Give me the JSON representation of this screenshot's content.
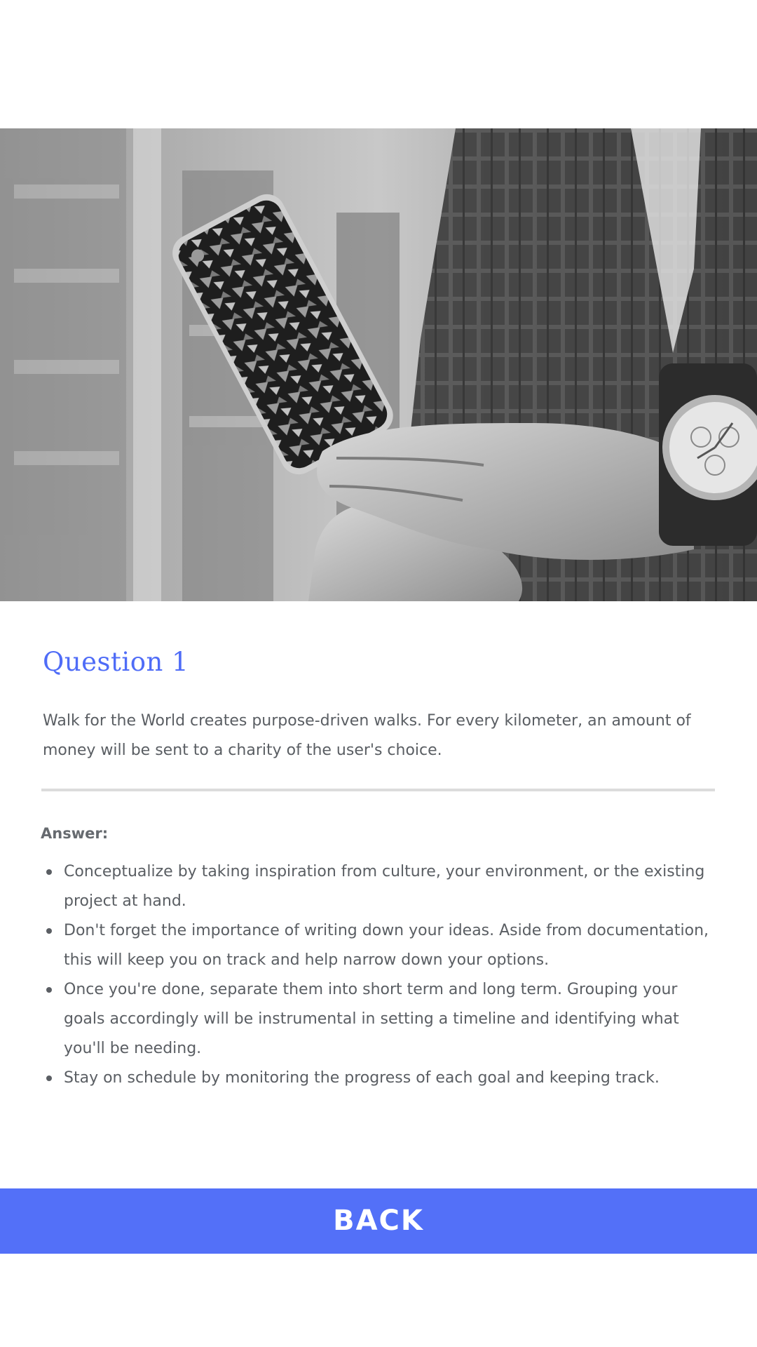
{
  "hero": {
    "image": "grayscale photo: person holding a smartphone, wearing a wristwatch",
    "alt_icon": "phone-photo"
  },
  "question": {
    "title": "Question 1",
    "description": "Walk for the World creates purpose-driven walks. For every kilometer, an amount of money will be sent to a charity of the user's choice."
  },
  "answer": {
    "label": "Answer:",
    "items": [
      "Conceptualize by taking inspiration from culture, your environment, or the existing project at hand.",
      "Don't forget the importance of writing down your ideas. Aside from documentation, this will keep you on track and help narrow down your options.",
      "Once you're done, separate them into short term and long term. Grouping your goals accordingly will be instrumental in setting a timeline and identifying what you'll be needing.",
      "Stay on schedule by monitoring the progress of each goal and keeping track."
    ]
  },
  "actions": {
    "back_label": "BACK"
  },
  "colors": {
    "accent": "#5370f8",
    "title": "#4f6cf7",
    "text": "#5a5e63",
    "divider": "#dcdcdc"
  }
}
